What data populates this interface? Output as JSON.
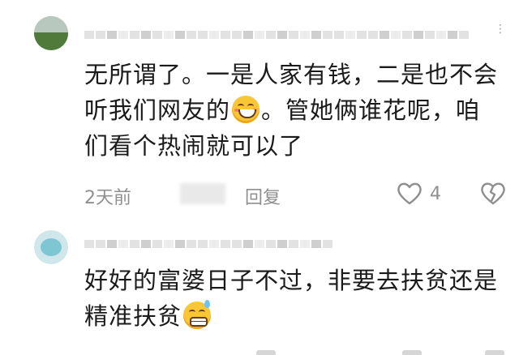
{
  "comments": [
    {
      "lines": [
        "无所谓了。一是人家有钱，二是也不会",
        "听我们网友的",
        "。管她俩谁花呢，咱",
        "们看个热闹就可以了"
      ],
      "emoji": "grinning-smile",
      "time": "2天前",
      "reply_label": "回复",
      "like_count": "4"
    },
    {
      "lines": [
        "好好的富婆日子不过，非要去扶贫还是",
        "精准扶贫"
      ],
      "emoji": "grinning-sweat"
    }
  ],
  "colors": {
    "text": "#1a1a1a",
    "meta": "#8f8f8f",
    "emoji": "#f9c635"
  }
}
